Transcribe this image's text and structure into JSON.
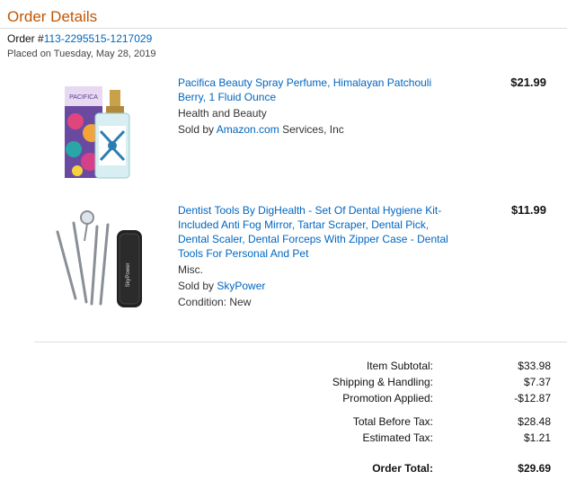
{
  "header": {
    "title": "Order Details",
    "order_prefix": "Order #",
    "order_number": "113-2295515-1217029",
    "placed_on": "Placed on Tuesday, May 28, 2019"
  },
  "items": [
    {
      "title": "Pacifica Beauty Spray Perfume, Himalayan Patchouli Berry, 1 Fluid Ounce",
      "category": "Health and Beauty",
      "sold_by_prefix": "Sold by ",
      "seller": "Amazon.com",
      "seller_suffix": " Services, Inc",
      "condition": "",
      "price": "$21.99",
      "image_text": "PACIFICA"
    },
    {
      "title": "Dentist Tools By DigHealth - Set Of Dental Hygiene Kit-Included Anti Fog Mirror, Tartar Scraper, Dental Pick, Dental Scaler, Dental Forceps With Zipper Case - Dental Tools For Personal And Pet",
      "category": "Misc.",
      "sold_by_prefix": "Sold by ",
      "seller": "SkyPower",
      "seller_suffix": "",
      "condition": "Condition: New",
      "price": "$11.99",
      "image_text": "SkyPower"
    }
  ],
  "summary": [
    {
      "label": "Item Subtotal:",
      "value": "$33.98"
    },
    {
      "label": "Shipping & Handling:",
      "value": "$7.37"
    },
    {
      "label": "Promotion Applied:",
      "value": "-$12.87"
    },
    {
      "label": "Total Before Tax:",
      "value": "$28.48"
    },
    {
      "label": "Estimated Tax:",
      "value": "$1.21"
    },
    {
      "label": "Order Total:",
      "value": "$29.69"
    }
  ],
  "colors": {
    "title": "#c45500",
    "link": "#0066c0"
  }
}
